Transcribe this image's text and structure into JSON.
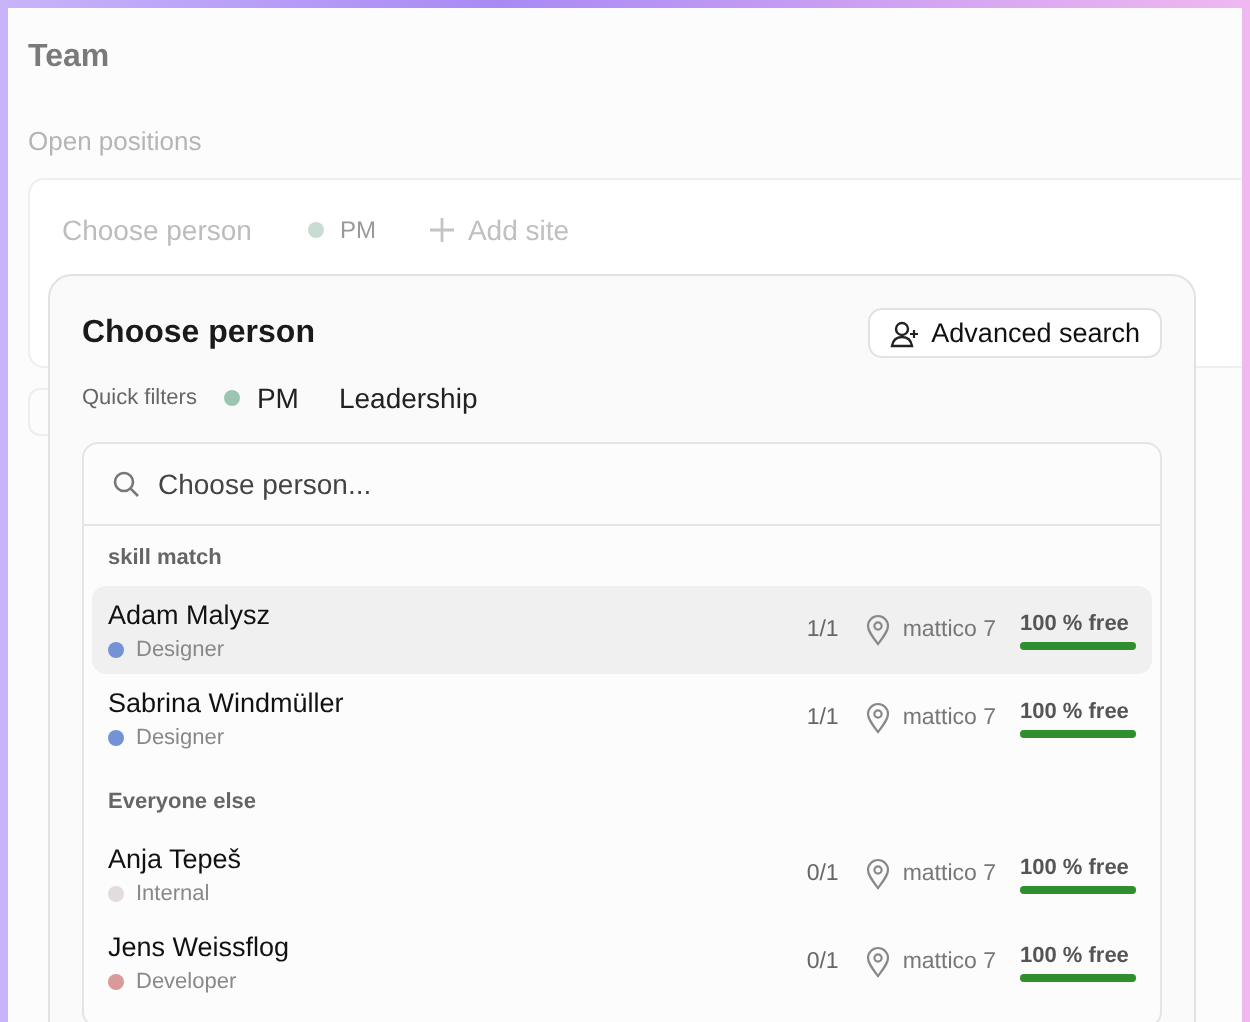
{
  "page": {
    "title": "Team",
    "section_label": "Open positions",
    "position_card": {
      "placeholder": "Choose person",
      "role_tag": {
        "label": "PM",
        "color": "#c9dcd3"
      },
      "add_site": "Add site"
    }
  },
  "popup": {
    "title": "Choose person",
    "advanced_search": "Advanced search",
    "quick_filters": {
      "label": "Quick filters",
      "items": [
        {
          "label": "PM",
          "color": "#9cc4b2"
        },
        {
          "label": "Leadership"
        }
      ]
    },
    "search": {
      "placeholder": "Choose person..."
    },
    "groups": [
      {
        "title": "skill match",
        "people": [
          {
            "name": "Adam Malysz",
            "role": "Designer",
            "color": "#7393d6",
            "count": "1/1",
            "site": "mattico 7",
            "availability": "100 % free",
            "level": 1,
            "selected": true
          },
          {
            "name": "Sabrina Windmüller",
            "role": "Designer",
            "color": "#7393d6",
            "count": "1/1",
            "site": "mattico 7",
            "availability": "100 % free",
            "level": 1,
            "selected": false
          }
        ]
      },
      {
        "title": "Everyone else",
        "people": [
          {
            "name": "Anja Tepeš",
            "role": "Internal",
            "color": "#e3dcdc",
            "count": "0/1",
            "site": "mattico 7",
            "availability": "100 % free",
            "level": 1,
            "selected": false
          },
          {
            "name": "Jens Weissflog",
            "role": "Developer",
            "color": "#d99a9a",
            "count": "0/1",
            "site": "mattico 7",
            "availability": "100 % free",
            "level": 1,
            "selected": false
          }
        ]
      }
    ]
  }
}
